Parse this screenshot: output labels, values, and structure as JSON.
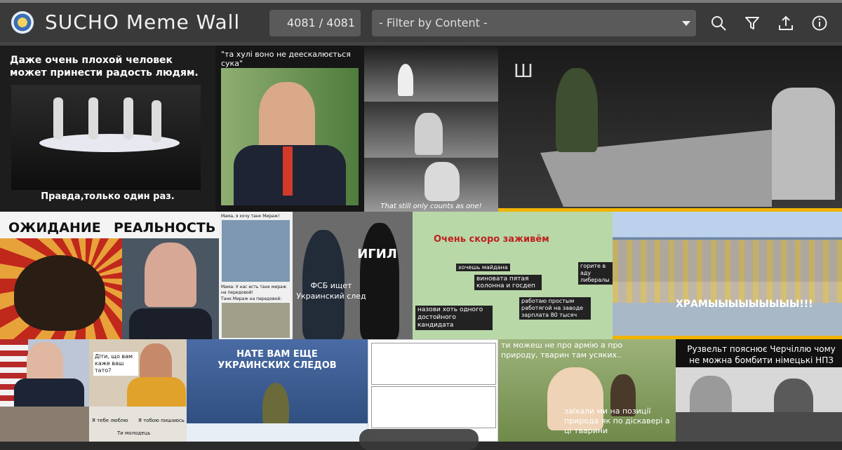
{
  "header": {
    "title": "SUCHO Meme Wall",
    "counter": "4081 / 4081",
    "filter_placeholder": "- Filter by Content -",
    "icons": [
      "search-icon",
      "filter-icon",
      "upload-icon",
      "info-icon"
    ]
  },
  "tiles": {
    "t1": {
      "top": "Даже очень плохой человек может принести радость людям.",
      "bottom": "Правда,только один раз."
    },
    "t2": {
      "caption": "\"та хулі воно не деескалюється сука\""
    },
    "t3": {
      "caption": "That still only counts as one!"
    },
    "t5": {
      "left": "ОЖИДАНИЕ",
      "right": "РЕАЛЬНОСТЬ"
    },
    "t6": {
      "line1": "Мама, я хочу танк Мираж!",
      "line2": "Мама: У нас есть танк мираж на передовой!",
      "line3": "Танк Мираж на передовой:"
    },
    "t7": {
      "big": "ИГИЛ",
      "small": "ФСБ ищет Украинский след"
    },
    "t8": {
      "title": "Очень скоро заживём",
      "b1": "хочешь майдана",
      "b2": "виновата пятая колонна и госдеп",
      "b3": "горите в аду либералы",
      "b4": "работаю простым работягой на заводе зарплата 80 тысяч",
      "b5": "назови хоть одного достойного кандидата"
    },
    "t9": {
      "caption": "ХРАМЫЫЫЫЫЫЫЫЫ!!!"
    },
    "t11": {
      "caption": "Діти, що вам каже ваш тато?"
    },
    "t12": {
      "line1": "Я тебе люблю",
      "line2": "Я тобою пишаюсь",
      "line3": "Ти молодець"
    },
    "t13": {
      "caption": "НАТЕ ВАМ ЕЩЕ УКРАИНСКИХ СЛЕДОВ"
    },
    "t15": {
      "top": "ти можеш не про армію а про природу, тварин там усяких..",
      "bottom": "заїхали ми на позиції природа як по діскавері а ці тварини"
    },
    "t16": {
      "caption": "Рузвельт пояснює Черчіллю чому не можна бомбити німецькі НПЗ"
    }
  },
  "colors": {
    "header_bg": "#3a3a3a",
    "field_bg": "#5a5a5a",
    "text": "#f2f2f2",
    "highlight_yellow": "#f0b400",
    "poster_red": "#c0281c"
  }
}
